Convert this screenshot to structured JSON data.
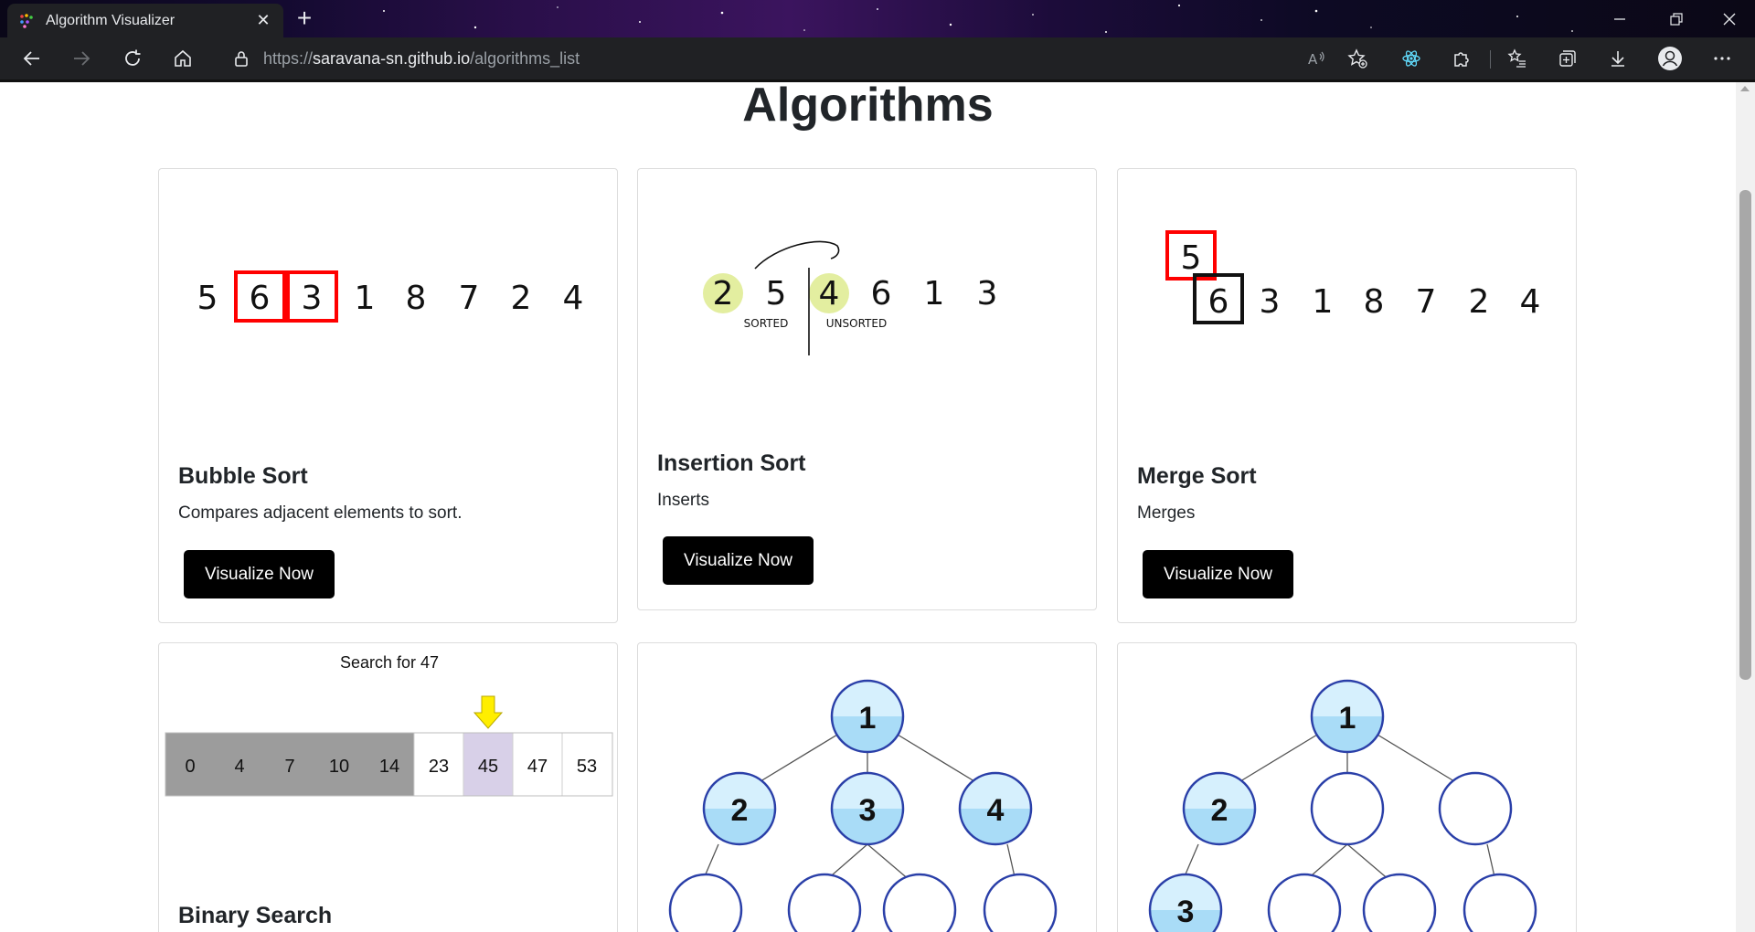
{
  "browser": {
    "tab_title": "Algorithm Visualizer",
    "tab_close": "✕",
    "new_tab": "+",
    "url_scheme": "https://",
    "url_host": "saravana-sn.github.io",
    "url_path": "/algorithms_list"
  },
  "page": {
    "title": "Algorithms"
  },
  "cards": [
    {
      "title": "Bubble Sort",
      "description": "Compares adjacent elements to sort.",
      "button": "Visualize Now",
      "illustration": {
        "numbers": [
          "5",
          "6",
          "3",
          "1",
          "8",
          "7",
          "2",
          "4"
        ],
        "highlight_color": "#ff0000"
      }
    },
    {
      "title": "Insertion Sort",
      "description": "Inserts",
      "button": "Visualize Now",
      "illustration": {
        "numbers": [
          "2",
          "5",
          "4",
          "6",
          "1",
          "3"
        ],
        "sorted_label": "SORTED",
        "unsorted_label": "UNSORTED",
        "highlight_color": "#e3eea0"
      }
    },
    {
      "title": "Merge Sort",
      "description": "Merges",
      "button": "Visualize Now",
      "illustration": {
        "top_number": "5",
        "numbers": [
          "6",
          "3",
          "1",
          "8",
          "7",
          "2",
          "4"
        ]
      }
    },
    {
      "title": "Binary Search",
      "illustration": {
        "caption": "Search for 47",
        "cells": [
          "0",
          "4",
          "7",
          "10",
          "14",
          "23",
          "45",
          "47",
          "53"
        ],
        "pointer_color": "#ffee00"
      }
    },
    {
      "illustration": {
        "nodes": [
          "1",
          "2",
          "3",
          "4"
        ]
      }
    },
    {
      "illustration": {
        "nodes": [
          "1",
          "2",
          "3"
        ]
      }
    }
  ]
}
